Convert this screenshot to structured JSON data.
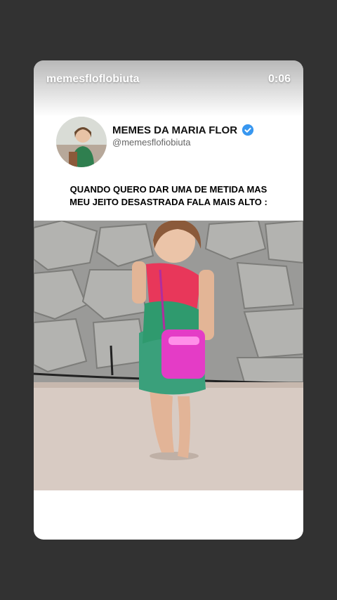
{
  "story": {
    "username": "memesfloflobiuta",
    "timer": "0:06"
  },
  "profile": {
    "name": "MEMES DA MARIA FLOR",
    "handle": "@memesflofiobiuta",
    "verified_icon": "verified-badge-icon",
    "verified_color": "#3897f0"
  },
  "post": {
    "caption_line1": "QUANDO QUERO DAR UMA DE METIDA MAS",
    "caption_line2": "MEU JEITO DESASTRADA FALA MAIS ALTO :"
  },
  "colors": {
    "background": "#323232",
    "card": "#ffffff"
  }
}
